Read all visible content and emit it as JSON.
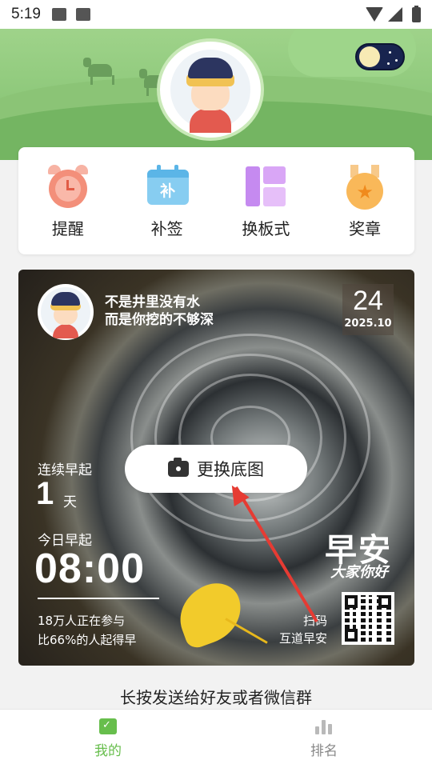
{
  "status_bar": {
    "time": "5:19"
  },
  "menu": {
    "items": [
      {
        "label": "提醒",
        "icon": "alarm-clock-icon"
      },
      {
        "label": "补签",
        "icon": "calendar-retro-checkin-icon",
        "icon_text": "补"
      },
      {
        "label": "换板式",
        "icon": "layout-icon"
      },
      {
        "label": "奖章",
        "icon": "medal-icon",
        "icon_text": "★"
      }
    ]
  },
  "poster": {
    "quote_line1": "不是井里没有水",
    "quote_line2": "而是你挖的不够深",
    "date_day": "24",
    "date_ym": "2025.10",
    "streak_label": "连续早起",
    "streak_value": "1",
    "streak_unit": "天",
    "today_label": "今日早起",
    "today_time": "08:00",
    "stat_participants": "18万人正在参与",
    "stat_ratio": "比66%的人起得早",
    "brand_title": "早安",
    "brand_subtitle": "大家你好",
    "scan_line1": "扫码",
    "scan_line2": "互道早安",
    "change_bg_label": "更换底图"
  },
  "share_hint": "长按发送给好友或者微信群",
  "bottom_nav": {
    "items": [
      {
        "label": "我的",
        "active": true
      },
      {
        "label": "排名",
        "active": false
      }
    ]
  },
  "colors": {
    "accent_green": "#67be4c",
    "arrow_red": "#e63b33",
    "night_toggle": "#18244f"
  }
}
